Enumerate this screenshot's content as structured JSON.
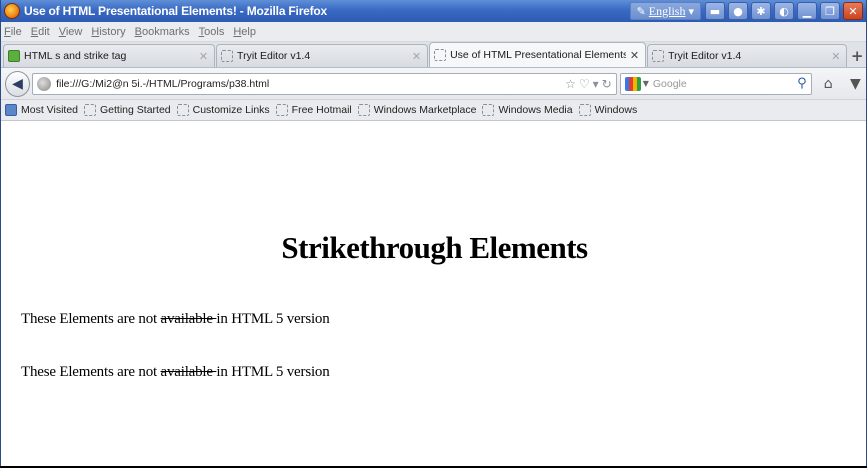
{
  "window": {
    "title": "Use of HTML Presentational Elements! - Mozilla Firefox",
    "language_button": "English"
  },
  "menu": [
    {
      "label": "File",
      "key": "F",
      "rest": "ile"
    },
    {
      "label": "Edit",
      "key": "E",
      "rest": "dit"
    },
    {
      "label": "View",
      "key": "V",
      "rest": "iew"
    },
    {
      "label": "History",
      "key": "H",
      "rest": "istory"
    },
    {
      "label": "Bookmarks",
      "key": "B",
      "rest": "ookmarks"
    },
    {
      "label": "Tools",
      "key": "T",
      "rest": "ools"
    },
    {
      "label": "Help",
      "key": "H",
      "rest": "elp"
    }
  ],
  "tabs": [
    {
      "label": "HTML s and strike tag",
      "icon": "green-page-icon"
    },
    {
      "label": "Tryit Editor v1.4",
      "icon": "blank-page-icon"
    },
    {
      "label": "Use of HTML Presentational Elements!",
      "icon": "blank-page-icon",
      "active": true
    },
    {
      "label": "Tryit Editor v1.4",
      "icon": "blank-page-icon"
    }
  ],
  "navigation": {
    "url": "file:///G:/Mi2@n 5i.-/HTML/Programs/p38.html",
    "search_placeholder": "Google"
  },
  "bookmarks": [
    {
      "label": "Most Visited"
    },
    {
      "label": "Getting Started"
    },
    {
      "label": "Customize Links"
    },
    {
      "label": "Free Hotmail"
    },
    {
      "label": "Windows Marketplace"
    },
    {
      "label": "Windows Media"
    },
    {
      "label": "Windows"
    }
  ],
  "page": {
    "heading": "Strikethrough Elements",
    "paragraphs": [
      {
        "before": "These Elements are not ",
        "struck": "available ",
        "after": "in HTML 5 version"
      },
      {
        "before": "These Elements are not ",
        "struck": "available ",
        "after": "in HTML 5 version"
      }
    ]
  }
}
